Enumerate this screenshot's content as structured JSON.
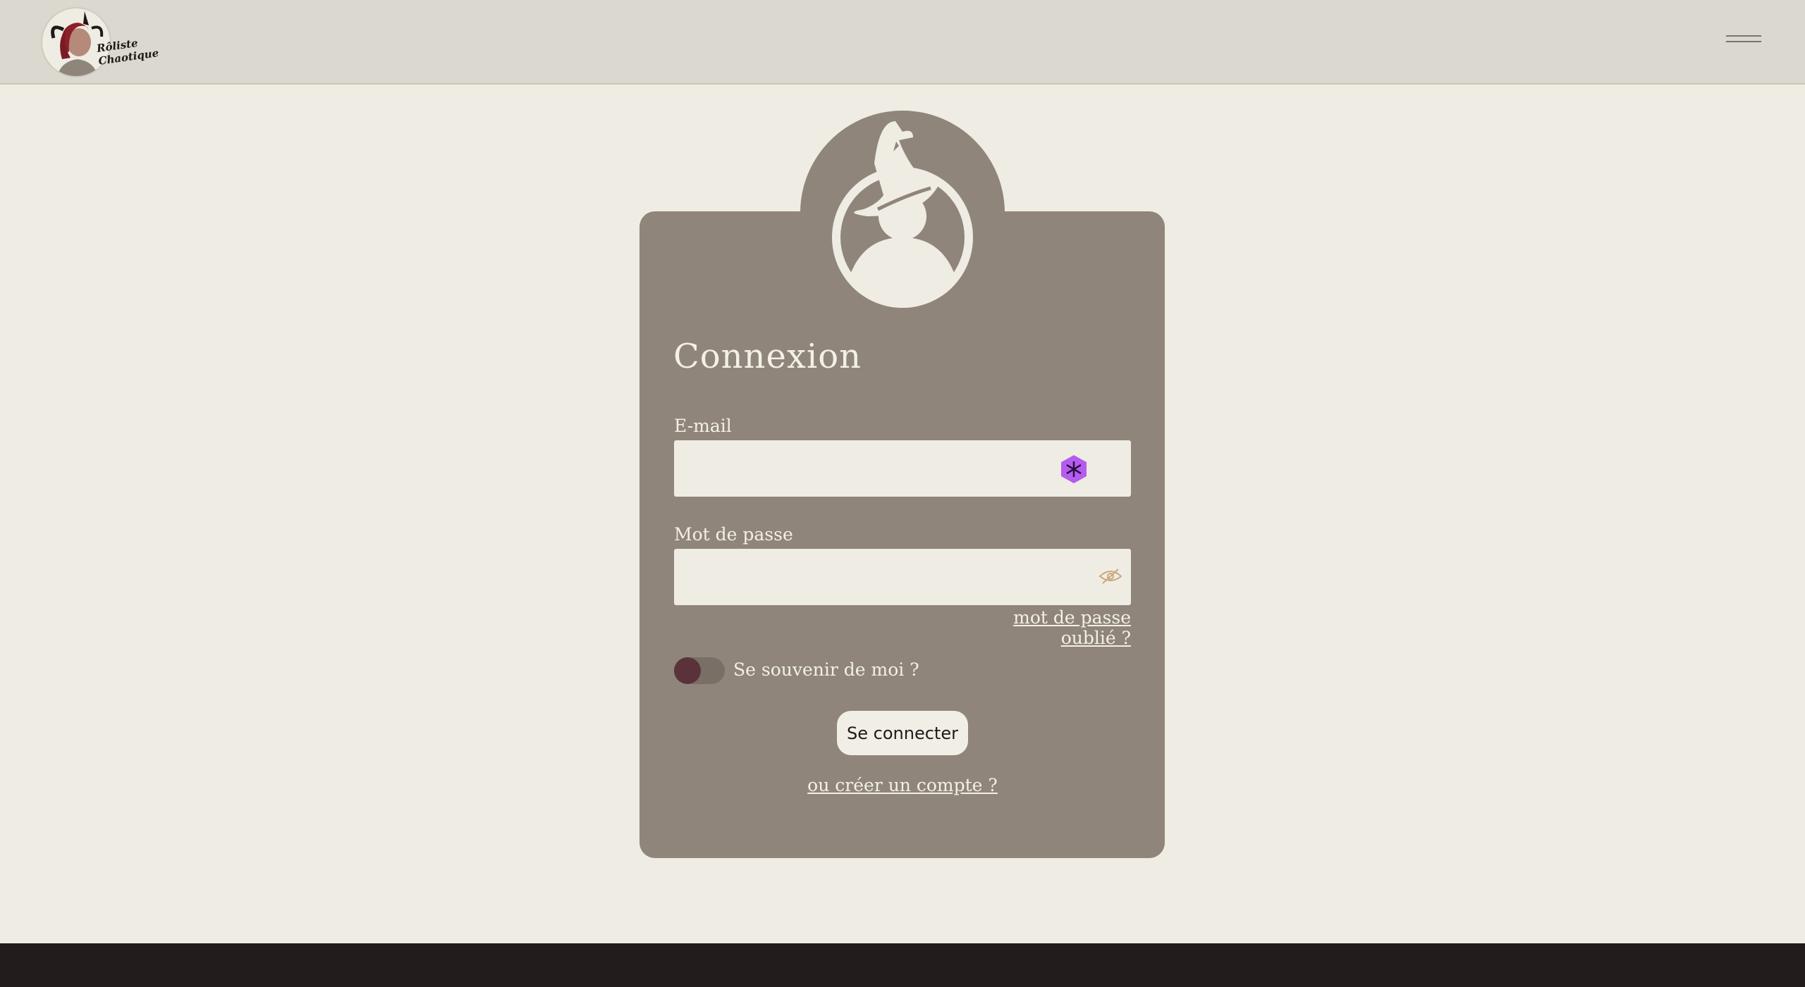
{
  "header": {
    "logo_text_line1": "Rôliste",
    "logo_text_line2": "Chaotique",
    "menu_icon": "hamburger-icon"
  },
  "login": {
    "title": "Connexion",
    "email_label": "E-mail",
    "email_value": "",
    "email_icon": "password-manager-icon",
    "password_label": "Mot de passe",
    "password_value": "",
    "password_icon": "eye-icon",
    "forgot_link": "mot de passe oublié ?",
    "remember_label": "Se souvenir de moi ?",
    "remember_checked": false,
    "submit_label": "Se connecter",
    "create_link": "ou créer un compte ?"
  },
  "colors": {
    "background": "#efece3",
    "card": "#8f857a",
    "header": "#dbd8cf",
    "footer": "#221d1c",
    "toggle_knob": "#5a333a",
    "email_icon": "#b45cf0"
  }
}
